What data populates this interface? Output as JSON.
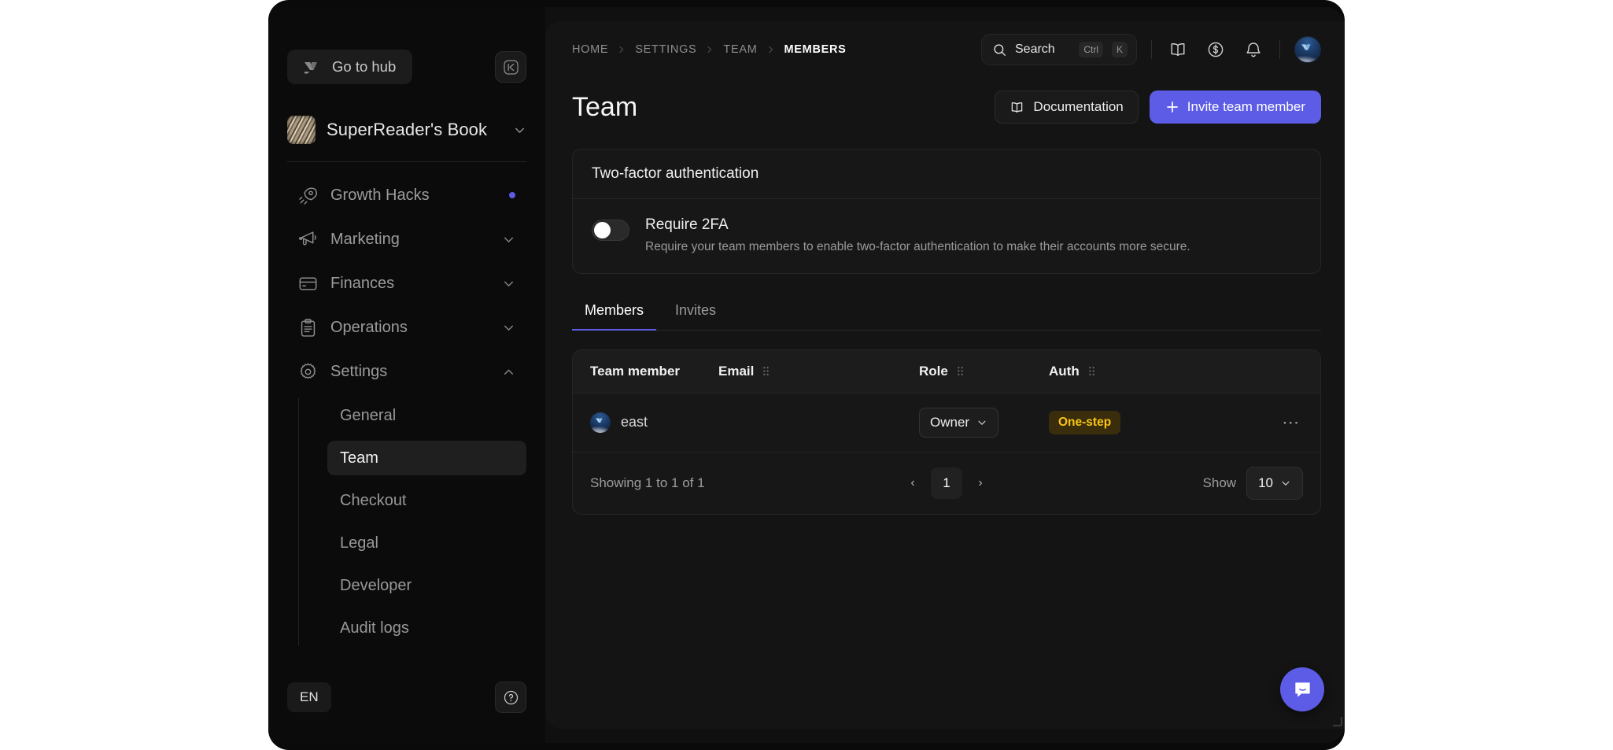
{
  "sidebar": {
    "hub_button": "Go to hub",
    "collapse_icon": "collapse-panel-icon",
    "workspace": {
      "name": "SuperReader's Book"
    },
    "nav": [
      {
        "label": "Growth Hacks",
        "icon": "rocket-icon",
        "badge_dot": true,
        "expandable": false
      },
      {
        "label": "Marketing",
        "icon": "megaphone-icon",
        "expandable": true,
        "expanded": false
      },
      {
        "label": "Finances",
        "icon": "credit-card-icon",
        "expandable": true,
        "expanded": false
      },
      {
        "label": "Operations",
        "icon": "clipboard-icon",
        "expandable": true,
        "expanded": false
      },
      {
        "label": "Settings",
        "icon": "gear-icon",
        "expandable": true,
        "expanded": true
      }
    ],
    "subnav": [
      {
        "label": "General",
        "active": false
      },
      {
        "label": "Team",
        "active": true
      },
      {
        "label": "Checkout",
        "active": false
      },
      {
        "label": "Legal",
        "active": false
      },
      {
        "label": "Developer",
        "active": false
      },
      {
        "label": "Audit logs",
        "active": false
      }
    ],
    "language": "EN",
    "help_icon": "help-circle-icon"
  },
  "topbar": {
    "breadcrumbs": [
      {
        "label": "HOME",
        "active": false
      },
      {
        "label": "SETTINGS",
        "active": false
      },
      {
        "label": "TEAM",
        "active": false
      },
      {
        "label": "MEMBERS",
        "active": true
      }
    ],
    "search": {
      "placeholder": "Search",
      "shortcut_modifier": "Ctrl",
      "shortcut_key": "K"
    },
    "icons": [
      "book-icon",
      "dollar-circle-icon",
      "bell-icon"
    ],
    "avatar": "user-avatar"
  },
  "page": {
    "title": "Team",
    "documentation_button": "Documentation",
    "invite_button": "Invite team member"
  },
  "two_factor": {
    "card_title": "Two-factor authentication",
    "toggle_label": "Require 2FA",
    "toggle_enabled": false,
    "description": "Require your team members to enable two-factor authentication to make their accounts more secure."
  },
  "tabs": [
    {
      "label": "Members",
      "active": true
    },
    {
      "label": "Invites",
      "active": false
    }
  ],
  "table": {
    "columns": [
      {
        "label": "Team member",
        "grip": false
      },
      {
        "label": "Email",
        "grip": true
      },
      {
        "label": "Role",
        "grip": true
      },
      {
        "label": "Auth",
        "grip": true
      }
    ],
    "rows": [
      {
        "member": "east",
        "email": "",
        "role": "Owner",
        "auth": "One-step",
        "menu": "⋯"
      }
    ]
  },
  "pagination": {
    "showing": "Showing 1 to 1 of 1",
    "prev": "‹",
    "current_page": "1",
    "next": "›",
    "show_label": "Show",
    "page_size": "10"
  },
  "chat": {
    "icon": "chat-bubble-icon"
  },
  "colors": {
    "accent": "#5D5CE6",
    "badge_text": "#FAC515",
    "badge_bg": "#3A2D0C",
    "app_bg": "#101010",
    "main_bg": "#141414"
  }
}
